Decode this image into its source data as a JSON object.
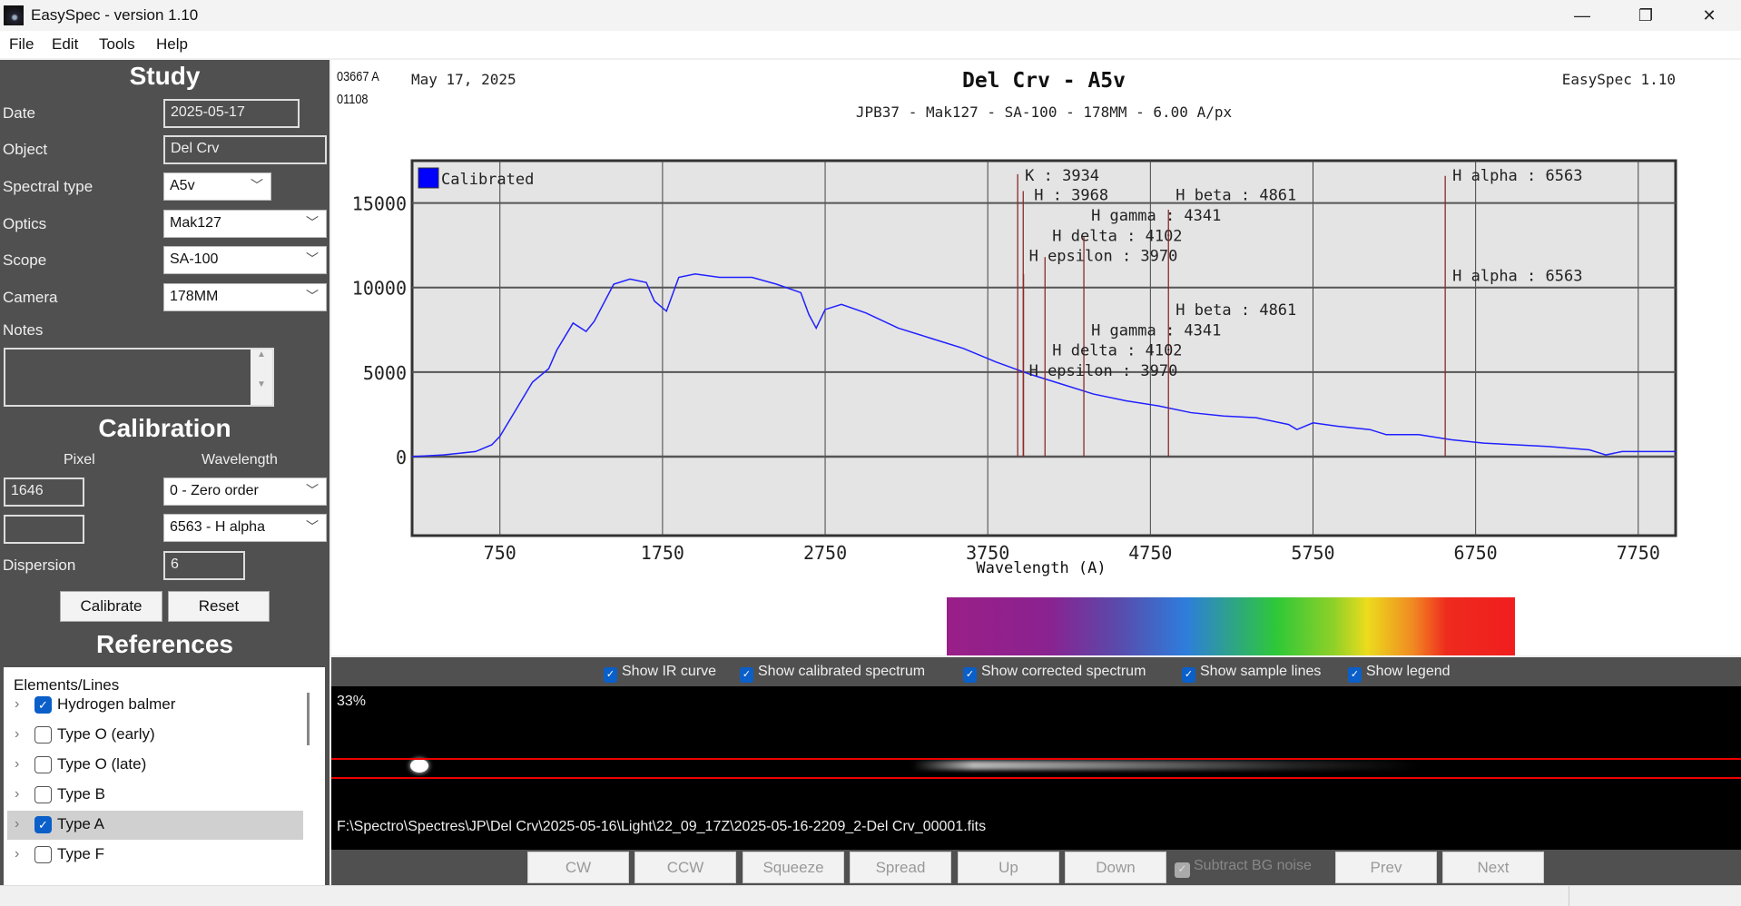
{
  "window": {
    "title": "EasySpec - version 1.10",
    "minimize": "—",
    "restore": "❐",
    "close": "✕"
  },
  "menu": [
    "File",
    "Edit",
    "Tools",
    "Help"
  ],
  "study": {
    "heading": "Study",
    "date_label": "Date",
    "date": "2025-05-17",
    "object_label": "Object",
    "object": "Del Crv",
    "spectral_label": "Spectral type",
    "spectral": "A5v",
    "optics_label": "Optics",
    "optics": "Mak127",
    "scope_label": "Scope",
    "scope": "SA-100",
    "camera_label": "Camera",
    "camera": "178MM",
    "notes_label": "Notes",
    "notes": ""
  },
  "calibration": {
    "heading": "Calibration",
    "pixel_label": "Pixel",
    "wavelength_label": "Wavelength",
    "pixel1": "1646",
    "pixel2": "",
    "wl1": "0 - Zero order",
    "wl2": "6563 - H alpha",
    "dispersion_label": "Dispersion",
    "dispersion": "6",
    "calibrate": "Calibrate",
    "reset": "Reset"
  },
  "references": {
    "heading": "References",
    "column": "Elements/Lines",
    "items": [
      {
        "label": "Hydrogen balmer",
        "checked": true
      },
      {
        "label": "Type O (early)",
        "checked": false
      },
      {
        "label": "Type O (late)",
        "checked": false
      },
      {
        "label": "Type B",
        "checked": false
      },
      {
        "label": "Type A",
        "checked": true,
        "selected": true
      },
      {
        "label": "Type F",
        "checked": false
      }
    ]
  },
  "chart_header": {
    "code1": "03667 A",
    "code2": "01108",
    "date": "May 17, 2025",
    "title": "Del Crv - A5v",
    "subtitle": "JPB37 - Mak127 - SA-100 - 178MM - 6.00 A/px",
    "version": "EasySpec 1.10"
  },
  "chart_data": {
    "type": "line",
    "xlabel": "Wavelength (A)",
    "ylabel": "",
    "xlim": [
      210,
      7980
    ],
    "ylim": [
      -4670,
      17500
    ],
    "xticks": [
      750,
      1750,
      2750,
      3750,
      4750,
      5750,
      6750,
      7750
    ],
    "yticks": [
      0,
      5000,
      10000,
      15000
    ],
    "grid": true,
    "legend": "top-left",
    "series": [
      {
        "name": "Calibrated",
        "color": "#2020ff",
        "x": [
          210,
          400,
          600,
          700,
          750,
          850,
          950,
          1050,
          1100,
          1200,
          1280,
          1330,
          1450,
          1550,
          1650,
          1700,
          1774,
          1850,
          1950,
          2100,
          2300,
          2450,
          2600,
          2650,
          2695,
          2750,
          2850,
          3000,
          3200,
          3400,
          3600,
          3800,
          4000,
          4200,
          4400,
          4600,
          4800,
          5000,
          5200,
          5400,
          5600,
          5651,
          5750,
          5900,
          6100,
          6200,
          6400,
          6600,
          6800,
          7000,
          7200,
          7450,
          7550,
          7650,
          7980
        ],
        "y": [
          0,
          100,
          300,
          700,
          1200,
          2800,
          4400,
          5200,
          6300,
          7900,
          7400,
          8000,
          10200,
          10500,
          10300,
          9200,
          8600,
          10600,
          10800,
          10600,
          10600,
          10200,
          9700,
          8400,
          7600,
          8700,
          9000,
          8500,
          7600,
          7000,
          6400,
          5600,
          4900,
          4300,
          3700,
          3300,
          3000,
          2600,
          2400,
          2300,
          1900,
          1600,
          2000,
          1800,
          1600,
          1300,
          1300,
          1000,
          800,
          700,
          600,
          400,
          100,
          300,
          300
        ]
      }
    ],
    "annotations": [
      {
        "label": "K : 3934",
        "x": 3934,
        "top": 16700
      },
      {
        "label": "H : 3968",
        "x": 3968,
        "top": 15700
      },
      {
        "label": "H epsilon : 3970",
        "x": 3970,
        "top": 10800
      },
      {
        "label": "H delta : 4102",
        "x": 4102,
        "top": 11800
      },
      {
        "label": "H gamma : 4341",
        "x": 4341,
        "top": 13000
      },
      {
        "label": "H beta : 4861",
        "x": 4861,
        "top": 14600
      },
      {
        "label": "H alpha : 6563",
        "x": 6563,
        "top": 16600
      }
    ],
    "annotations_lower": [
      "H alpha : 6563",
      "H beta : 4861",
      "H gamma : 4341",
      "H delta : 4102",
      "H epsilon : 3970"
    ]
  },
  "options": [
    "Show IR curve",
    "Show calibrated spectrum",
    "Show corrected spectrum",
    "Show sample lines",
    "Show legend"
  ],
  "image": {
    "zoom": "33%",
    "path": "F:\\Spectro\\Spectres\\JP\\Del Crv\\2025-05-16\\Light\\22_09_17Z\\2025-05-16-2209_2-Del Crv_00001.fits"
  },
  "buttons": [
    "CW",
    "CCW",
    "Squeeze",
    "Spread",
    "Up",
    "Down"
  ],
  "subtract_bg": "Subtract BG noise",
  "nav": [
    "Prev",
    "Next"
  ]
}
